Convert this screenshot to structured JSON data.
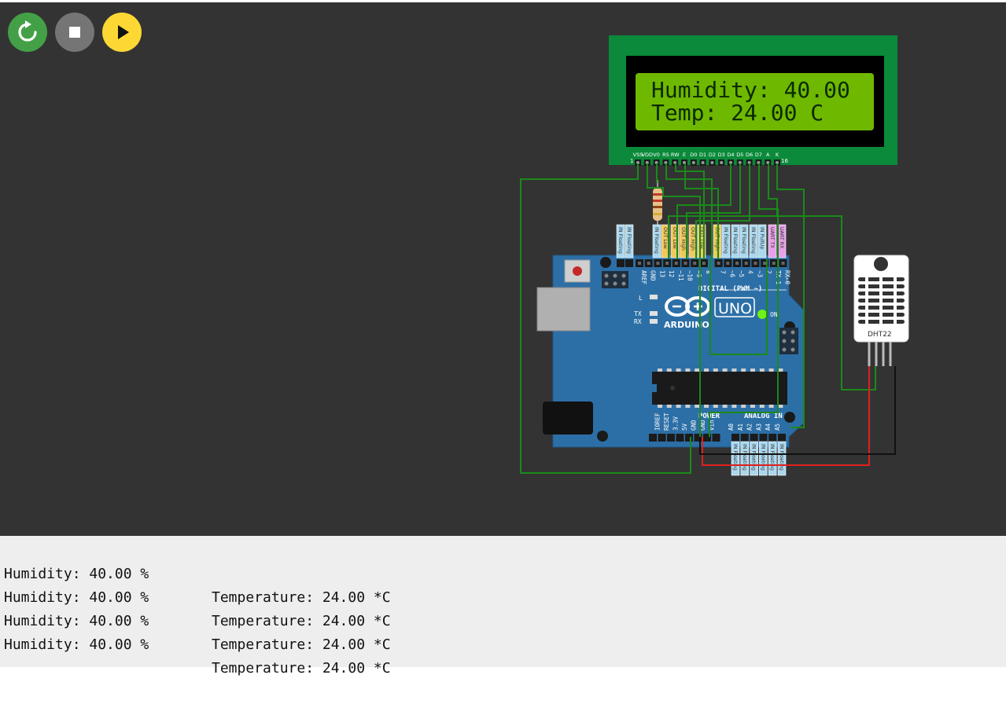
{
  "toolbar": {
    "restart_icon": "restart-icon",
    "stop_icon": "stop-icon",
    "play_icon": "play-icon"
  },
  "lcd": {
    "line1": "Humidity: 40.00",
    "line2": "Temp: 24.00 C",
    "pins": [
      "VSS",
      "VDD",
      "V0",
      "RS",
      "RW",
      "E",
      "D0",
      "D1",
      "D2",
      "D3",
      "D4",
      "D5",
      "D6",
      "D7",
      "A",
      "K"
    ],
    "pin_first": "1",
    "pin_last": "16",
    "screen_color": "#6fb800",
    "board_color": "#0a8a3a"
  },
  "arduino": {
    "brand": "ARDUINO",
    "model": "UNO",
    "digital_label": "DIGITAL (PWM ~)",
    "power_label": "POWER",
    "analog_label": "ANALOG IN",
    "led_l": "L",
    "led_tx": "TX",
    "led_rx": "RX",
    "led_on": "ON",
    "digital_pins": [
      "AREF",
      "GND",
      "13",
      "12",
      "~11",
      "~10",
      "~9",
      "8",
      "7",
      "~6",
      "~5",
      "4",
      "~3",
      "2",
      "TX→1",
      "RX←0"
    ],
    "power_pins": [
      "IOREF",
      "RESET",
      "3.3V",
      "5V",
      "GND",
      "GND",
      "Vin"
    ],
    "analog_pins": [
      "A0",
      "A1",
      "A2",
      "A3",
      "A4",
      "A5"
    ],
    "board_color": "#2c6fa6"
  },
  "pin_states_top": [
    {
      "label": "IN Floating",
      "color": "#aad8ef"
    },
    {
      "label": "IN Floating",
      "color": "#aad8ef"
    },
    {
      "label": "IN Floating",
      "color": "#aad8ef"
    },
    {
      "label": "OUT Low",
      "color": "#f0c95c"
    },
    {
      "label": "OUT Low",
      "color": "#f0c95c"
    },
    {
      "label": "OUT High",
      "color": "#f0c95c"
    },
    {
      "label": "OUT High",
      "color": "#f0c95c"
    },
    {
      "label": "OUT Low",
      "color": "#f0c95c"
    },
    {
      "label": "OUT High",
      "color": "#f0c95c"
    },
    {
      "label": "IN Floating",
      "color": "#aad8ef"
    },
    {
      "label": "IN Floating",
      "color": "#aad8ef"
    },
    {
      "label": "IN Floating",
      "color": "#aad8ef"
    },
    {
      "label": "IN Floating",
      "color": "#aad8ef"
    },
    {
      "label": "IN PullUp",
      "color": "#aad8ef"
    },
    {
      "label": "UART TX",
      "color": "#e8a0e8"
    },
    {
      "label": "UART RX",
      "color": "#e8a0e8"
    }
  ],
  "pin_states_bottom": [
    {
      "label": "IN Floating",
      "color": "#aad8ef"
    },
    {
      "label": "IN Floating",
      "color": "#aad8ef"
    },
    {
      "label": "IN Floating",
      "color": "#aad8ef"
    },
    {
      "label": "IN Floating",
      "color": "#aad8ef"
    },
    {
      "label": "IN Floating",
      "color": "#aad8ef"
    },
    {
      "label": "IN Floating",
      "color": "#aad8ef"
    }
  ],
  "dht": {
    "label": "DHT22"
  },
  "serial": {
    "lines": [
      {
        "humidity": "Humidity: 40.00 %",
        "temperature": "Temperature: 24.00 *C"
      },
      {
        "humidity": "Humidity: 40.00 %",
        "temperature": "Temperature: 24.00 *C"
      },
      {
        "humidity": "Humidity: 40.00 %",
        "temperature": "Temperature: 24.00 *C"
      },
      {
        "humidity": "Humidity: 40.00 %",
        "temperature": "Temperature: 24.00 *C"
      }
    ]
  },
  "colors": {
    "canvas_bg": "#333333",
    "wire_green": "#1a8a1a",
    "wire_red": "#e02020",
    "wire_black": "#111111",
    "console_bg": "#eeeeee"
  }
}
